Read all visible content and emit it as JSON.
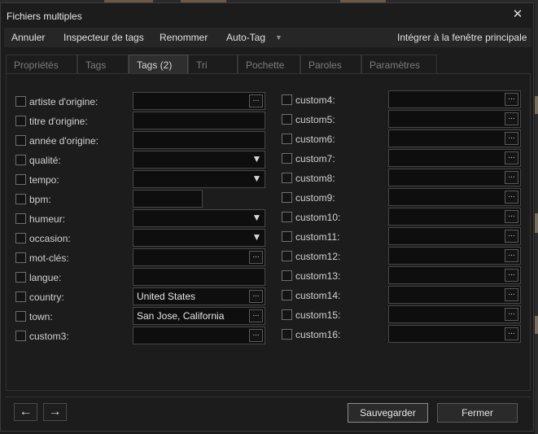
{
  "window": {
    "title": "Fichiers multiples",
    "close_glyph": "✕"
  },
  "menu": {
    "cancel": "Annuler",
    "tag_inspector": "Inspecteur de tags",
    "rename": "Renommer",
    "auto_tag": "Auto-Tag",
    "auto_tag_caret": "▼",
    "embed": "Intégrer à la fenêtre principale"
  },
  "tabs": [
    {
      "label": "Propriétés",
      "active": false
    },
    {
      "label": "Tags",
      "active": false
    },
    {
      "label": "Tags (2)",
      "active": true
    },
    {
      "label": "Tri",
      "active": false
    },
    {
      "label": "Pochette",
      "active": false
    },
    {
      "label": "Paroles",
      "active": false
    },
    {
      "label": "Paramètres",
      "active": false
    }
  ],
  "left_fields": [
    {
      "label": "artiste d'origine:",
      "value": "",
      "control": "ellipsis"
    },
    {
      "label": "titre d'origine:",
      "value": "",
      "control": "none"
    },
    {
      "label": "année d'origine:",
      "value": "",
      "control": "none"
    },
    {
      "label": "qualité:",
      "value": "",
      "control": "dropdown"
    },
    {
      "label": "tempo:",
      "value": "",
      "control": "dropdown"
    },
    {
      "label": "bpm:",
      "value": "",
      "control": "short"
    },
    {
      "label": "humeur:",
      "value": "",
      "control": "dropdown"
    },
    {
      "label": "occasion:",
      "value": "",
      "control": "dropdown"
    },
    {
      "label": "mot-clés:",
      "value": "",
      "control": "ellipsis"
    },
    {
      "label": "langue:",
      "value": "",
      "control": "none"
    },
    {
      "label": "country:",
      "value": "United States",
      "control": "ellipsis"
    },
    {
      "label": "town:",
      "value": "San Jose, California",
      "control": "ellipsis"
    },
    {
      "label": "custom3:",
      "value": "",
      "control": "ellipsis"
    }
  ],
  "right_fields": [
    {
      "label": "custom4:",
      "value": ""
    },
    {
      "label": "custom5:",
      "value": ""
    },
    {
      "label": "custom6:",
      "value": ""
    },
    {
      "label": "custom7:",
      "value": ""
    },
    {
      "label": "custom8:",
      "value": ""
    },
    {
      "label": "custom9:",
      "value": ""
    },
    {
      "label": "custom10:",
      "value": ""
    },
    {
      "label": "custom11:",
      "value": ""
    },
    {
      "label": "custom12:",
      "value": ""
    },
    {
      "label": "custom13:",
      "value": ""
    },
    {
      "label": "custom14:",
      "value": ""
    },
    {
      "label": "custom15:",
      "value": ""
    },
    {
      "label": "custom16:",
      "value": ""
    }
  ],
  "ellipsis_glyph": "...",
  "dropdown_glyph": "▼",
  "footer": {
    "back_glyph": "←",
    "forward_glyph": "→",
    "save": "Sauvegarder",
    "close": "Fermer"
  },
  "colors": {
    "background": "#1c1c1c",
    "field_bg": "#0e0e0e",
    "active_tab": "#2e2e2e"
  }
}
